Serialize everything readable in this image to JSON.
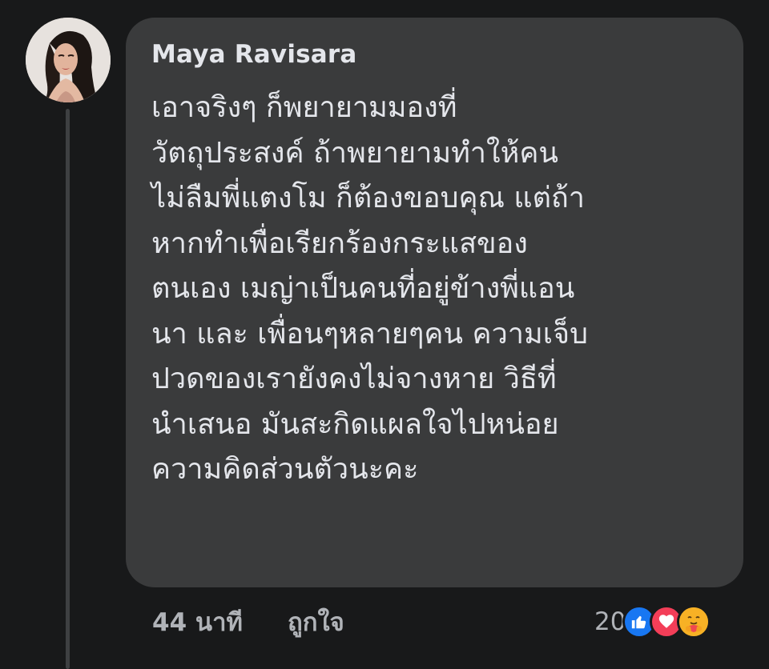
{
  "comment": {
    "author": "Maya Ravisara",
    "lines": [
      "เอาจริงๆ ก็พยายามมองที่",
      "วัตถุประสงค์ ถ้าพยายามทำให้คน",
      "ไม่ลืมพี่แตงโม ก็ต้องขอบคุณ แต่ถ้า",
      "หากทำเพื่อเรียกร้องกระแสของ",
      "ตนเอง เมญ่าเป็นคนที่อยู่ข้างพี่แอน",
      "นา และ เพื่อนๆหลายๆคน ความเจ็บ",
      "ปวดของเรายังคงไม่จางหาย วิธีที่",
      "นำเสนอ มันสะกิดแผลใจไปหน่อย",
      "ความคิดส่วนตัวนะคะ"
    ]
  },
  "meta": {
    "time": "44 นาที",
    "like_action": "ถูกใจ"
  },
  "reactions": {
    "count": "20",
    "icons": [
      "like-icon",
      "love-icon",
      "care-icon"
    ]
  },
  "colors": {
    "background": "#18191a",
    "bubble": "#3a3b3c",
    "text": "#e4e6eb",
    "secondary_text": "#b0b3b8",
    "like_blue": "#1877f2",
    "love_red": "#f33e58",
    "care_yellow": "#f7b125"
  }
}
